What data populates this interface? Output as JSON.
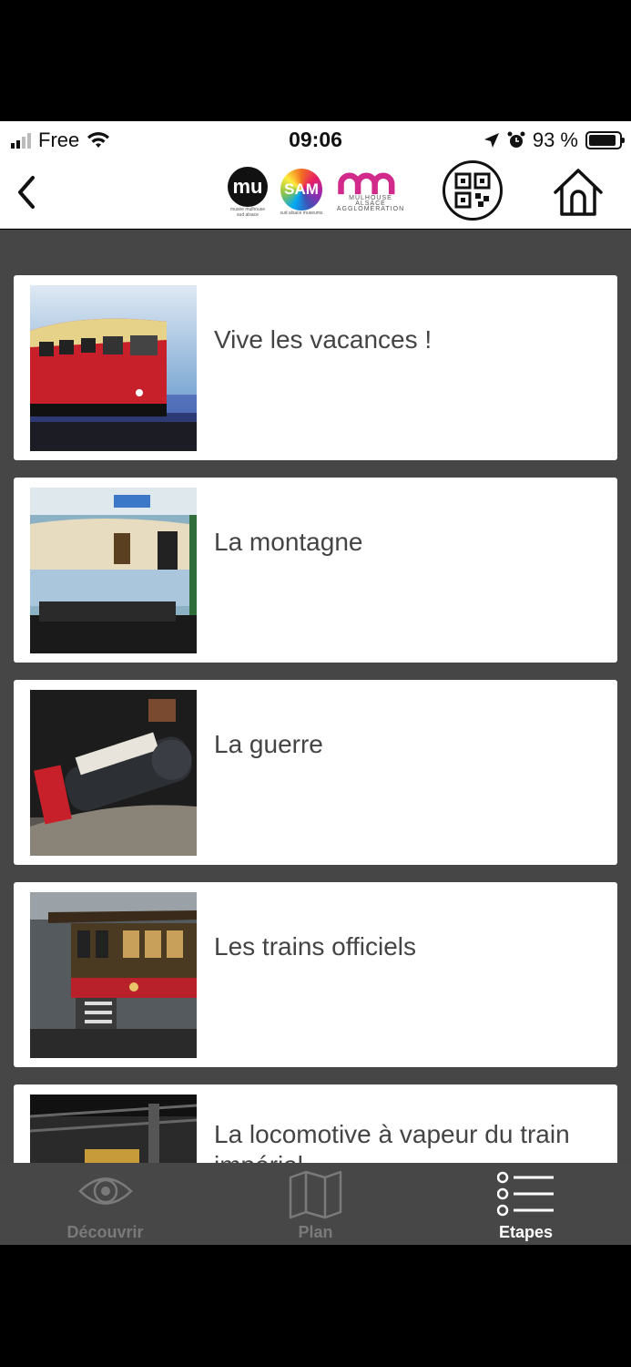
{
  "status_bar": {
    "carrier": "Free",
    "time": "09:06",
    "battery_text": "93 %"
  },
  "header": {
    "logos": {
      "mu": "mu",
      "mu_caption": "musée mulhouse sud alsace",
      "sam": "SAM",
      "sam_caption": "sud alsace museums",
      "m_caption_line1": "MULHOUSE ALSACE",
      "m_caption_line2": "AGGLOMÉRATION"
    },
    "brand_color": "#d12a8a"
  },
  "steps": [
    {
      "title": "Vive les vacances !"
    },
    {
      "title": "La montagne"
    },
    {
      "title": "La guerre"
    },
    {
      "title": "Les trains officiels"
    },
    {
      "title": "La locomotive à vapeur du train impérial"
    }
  ],
  "tabs": [
    {
      "label": "Découvrir",
      "icon": "eye-icon",
      "active": false
    },
    {
      "label": "Plan",
      "icon": "map-icon",
      "active": false
    },
    {
      "label": "Etapes",
      "icon": "list-icon",
      "active": true
    }
  ],
  "colors": {
    "content_bg": "#464646",
    "tab_active": "#ffffff",
    "tab_inactive": "#7a7a7a"
  }
}
